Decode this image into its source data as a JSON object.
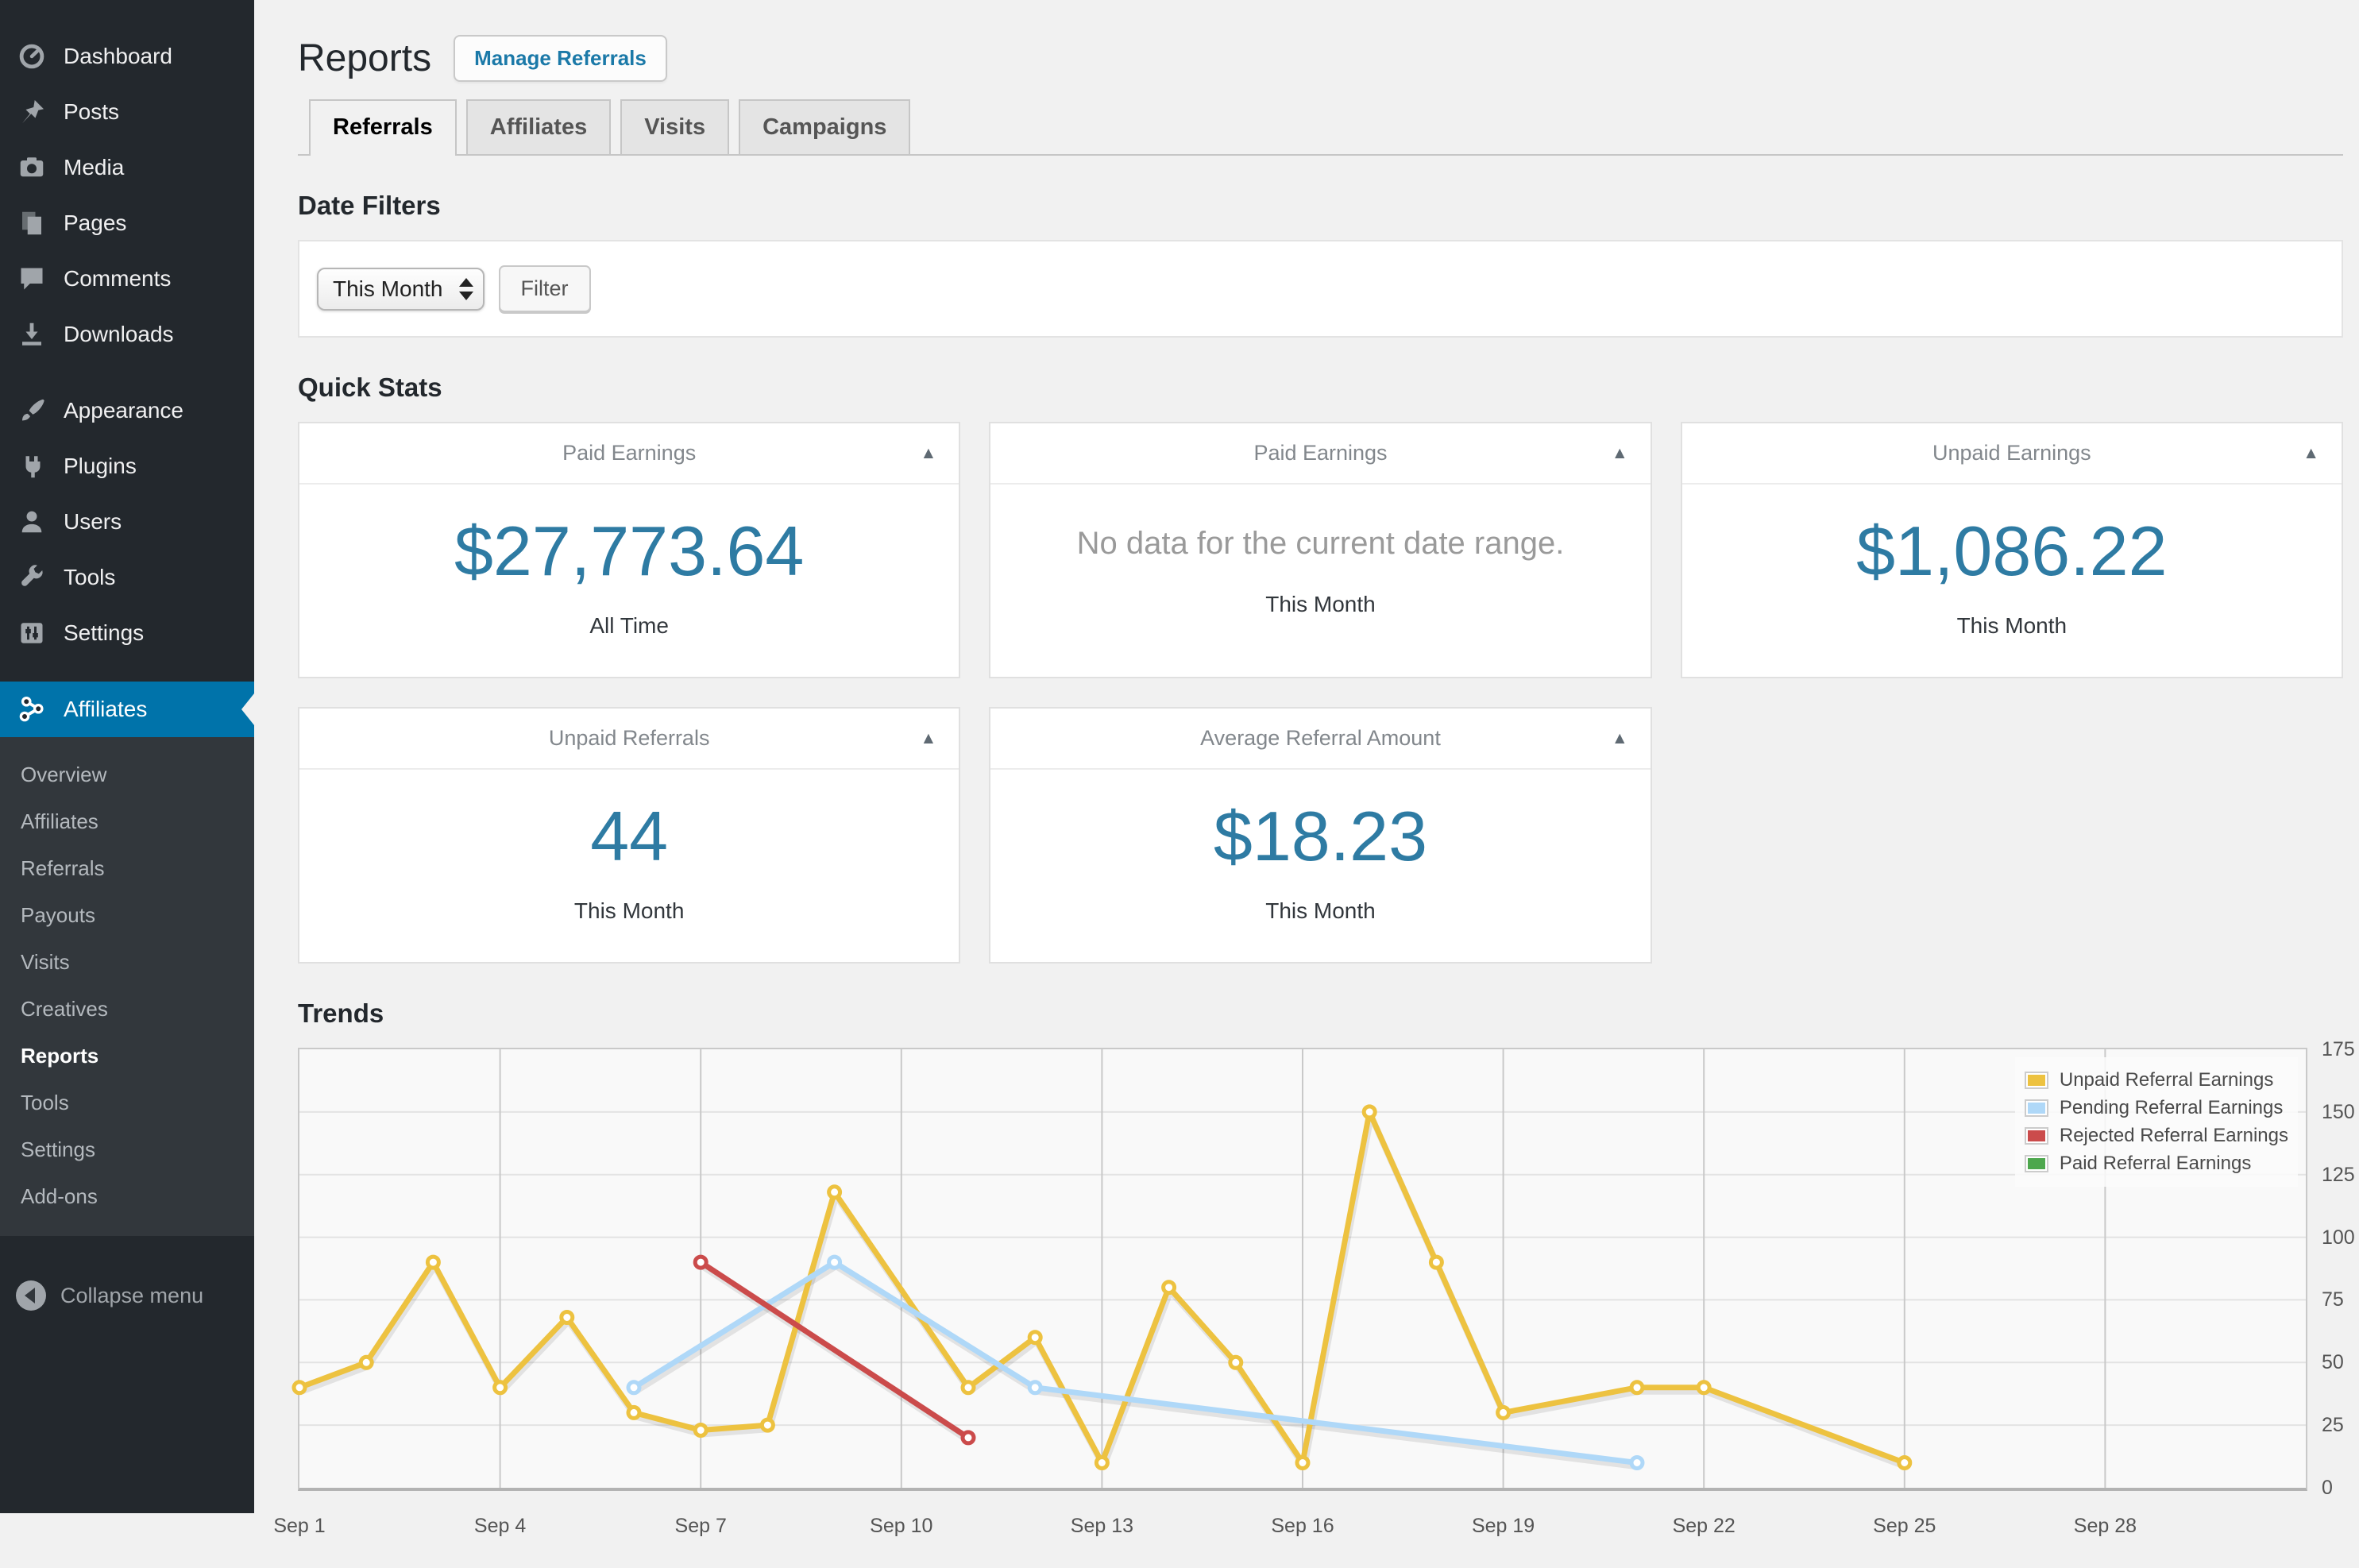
{
  "sidebar": {
    "items": [
      {
        "label": "Dashboard",
        "icon": "dashboard-icon"
      },
      {
        "label": "Posts",
        "icon": "posts-icon"
      },
      {
        "label": "Media",
        "icon": "media-icon"
      },
      {
        "label": "Pages",
        "icon": "pages-icon"
      },
      {
        "label": "Comments",
        "icon": "comments-icon"
      },
      {
        "label": "Downloads",
        "icon": "downloads-icon"
      },
      {
        "separator": true
      },
      {
        "label": "Appearance",
        "icon": "appearance-icon"
      },
      {
        "label": "Plugins",
        "icon": "plugins-icon"
      },
      {
        "label": "Users",
        "icon": "users-icon"
      },
      {
        "label": "Tools",
        "icon": "tools-icon"
      },
      {
        "label": "Settings",
        "icon": "settings-icon"
      },
      {
        "separator": true
      },
      {
        "label": "Affiliates",
        "icon": "affiliates-icon",
        "active": true
      }
    ],
    "submenu": [
      {
        "label": "Overview"
      },
      {
        "label": "Affiliates"
      },
      {
        "label": "Referrals"
      },
      {
        "label": "Payouts"
      },
      {
        "label": "Visits"
      },
      {
        "label": "Creatives"
      },
      {
        "label": "Reports",
        "active": true
      },
      {
        "label": "Tools"
      },
      {
        "label": "Settings"
      },
      {
        "label": "Add-ons"
      }
    ],
    "collapse_label": "Collapse menu",
    "colors": {
      "bg": "#23282d",
      "submenu_bg": "#32373c",
      "active_bg": "#0073aa"
    }
  },
  "header": {
    "title": "Reports",
    "action_label": "Manage Referrals"
  },
  "tabs": [
    {
      "label": "Referrals",
      "active": true
    },
    {
      "label": "Affiliates"
    },
    {
      "label": "Visits"
    },
    {
      "label": "Campaigns"
    }
  ],
  "sections": {
    "date_filters": "Date Filters",
    "quick_stats": "Quick Stats",
    "trends": "Trends"
  },
  "filter": {
    "select_value": "This Month",
    "button_label": "Filter"
  },
  "stats_cards": [
    {
      "title": "Paid Earnings",
      "value": "$27,773.64",
      "label": "All Time"
    },
    {
      "title": "Paid Earnings",
      "message": "No data for the current date range.",
      "label": "This Month"
    },
    {
      "title": "Unpaid Earnings",
      "value": "$1,086.22",
      "label": "This Month"
    },
    {
      "title": "Unpaid Referrals",
      "value": "44",
      "label": "This Month"
    },
    {
      "title": "Average Referral Amount",
      "value": "$18.23",
      "label": "This Month"
    }
  ],
  "icons": {
    "card_toggle": "triangle-up-icon",
    "select_arrows": "up-down-arrows-icon",
    "collapse": "collapse-circle-icon"
  },
  "accent_colors": {
    "link_blue": "#1b79a8",
    "stat_value_blue": "#2e7ba3"
  },
  "chart_data": {
    "type": "line",
    "title": "Trends",
    "xlabel": "",
    "ylabel": "",
    "ylim": [
      0,
      175
    ],
    "x_range_days": [
      1,
      31
    ],
    "grid": true,
    "legend_position": "top-right",
    "y_ticks": [
      0,
      25,
      50,
      75,
      100,
      125,
      150,
      175
    ],
    "x_ticks": [
      {
        "day": 1,
        "label": "Sep 1"
      },
      {
        "day": 4,
        "label": "Sep 4"
      },
      {
        "day": 7,
        "label": "Sep 7"
      },
      {
        "day": 10,
        "label": "Sep 10"
      },
      {
        "day": 13,
        "label": "Sep 13"
      },
      {
        "day": 16,
        "label": "Sep 16"
      },
      {
        "day": 19,
        "label": "Sep 19"
      },
      {
        "day": 22,
        "label": "Sep 22"
      },
      {
        "day": 25,
        "label": "Sep 25"
      },
      {
        "day": 28,
        "label": "Sep 28"
      }
    ],
    "series": [
      {
        "name": "Unpaid Referral Earnings",
        "color": "#edc240",
        "points": [
          [
            1,
            40
          ],
          [
            2,
            50
          ],
          [
            3,
            90
          ],
          [
            4,
            40
          ],
          [
            5,
            68
          ],
          [
            6,
            30
          ],
          [
            7,
            23
          ],
          [
            8,
            25
          ],
          [
            9,
            118
          ],
          [
            11,
            40
          ],
          [
            12,
            60
          ],
          [
            13,
            10
          ],
          [
            14,
            80
          ],
          [
            15,
            50
          ],
          [
            16,
            10
          ],
          [
            17,
            150
          ],
          [
            18,
            90
          ],
          [
            19,
            30
          ],
          [
            21,
            40
          ],
          [
            22,
            40
          ],
          [
            25,
            10
          ]
        ]
      },
      {
        "name": "Pending Referral Earnings",
        "color": "#afd8f8",
        "points": [
          [
            6,
            40
          ],
          [
            9,
            90
          ],
          [
            12,
            40
          ],
          [
            21,
            10
          ]
        ]
      },
      {
        "name": "Rejected Referral Earnings",
        "color": "#cb4b4b",
        "points": [
          [
            7,
            90
          ],
          [
            11,
            20
          ]
        ]
      },
      {
        "name": "Paid Referral Earnings",
        "color": "#4da74d",
        "points": []
      }
    ]
  }
}
